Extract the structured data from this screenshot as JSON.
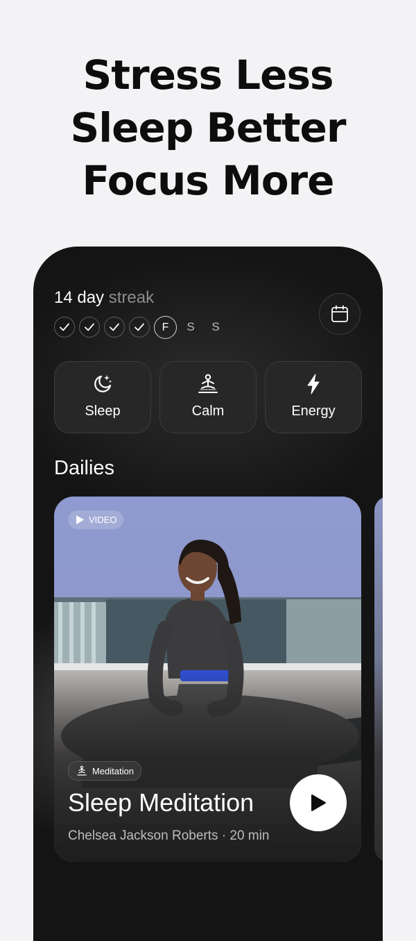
{
  "headline": [
    "Stress Less",
    "Sleep Better",
    "Focus More"
  ],
  "streak": {
    "count_label": "14 day",
    "suffix": "streak",
    "days": [
      {
        "state": "done",
        "label": ""
      },
      {
        "state": "done",
        "label": ""
      },
      {
        "state": "done",
        "label": ""
      },
      {
        "state": "done",
        "label": ""
      },
      {
        "state": "today",
        "label": "F"
      },
      {
        "state": "future",
        "label": "S"
      },
      {
        "state": "future",
        "label": "S"
      }
    ]
  },
  "calendar_icon": "calendar-icon",
  "categories": [
    {
      "label": "Sleep",
      "icon": "moon-stars-icon"
    },
    {
      "label": "Calm",
      "icon": "meditation-icon"
    },
    {
      "label": "Energy",
      "icon": "lightning-icon"
    }
  ],
  "dailies": {
    "heading": "Dailies",
    "card": {
      "badge": "VIDEO",
      "category": "Meditation",
      "title": "Sleep Meditation",
      "subtitle": "Chelsea Jackson Roberts · 20 min"
    }
  },
  "colors": {
    "background": "#f3f3f5",
    "phone": "#141414",
    "tile": "#272727",
    "accent_band": "#2f4fcf"
  }
}
